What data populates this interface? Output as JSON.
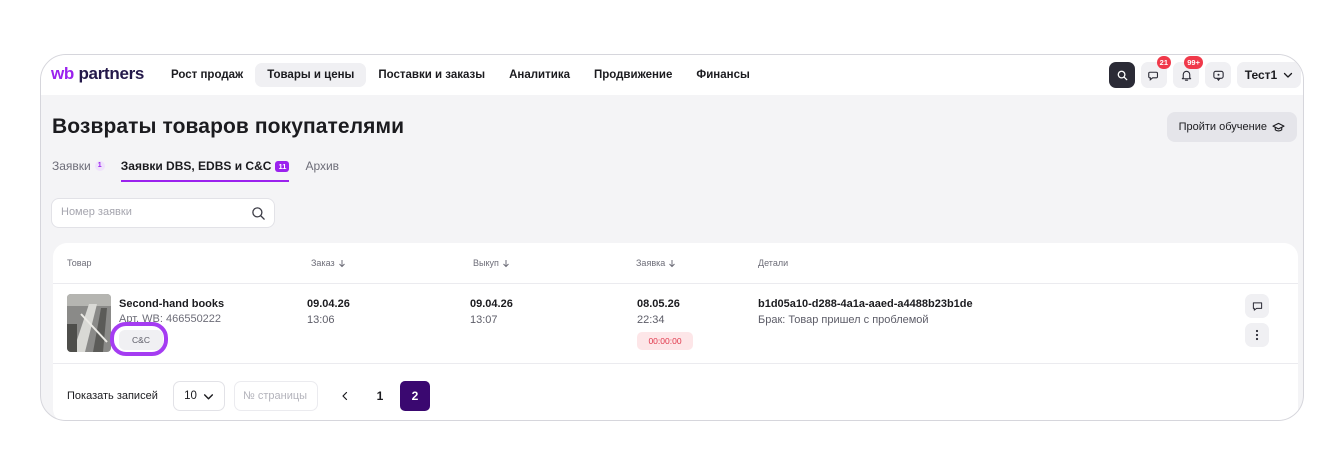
{
  "header": {
    "logo_wb": "wb",
    "logo_partners": "partners",
    "nav": [
      {
        "label": "Рост продаж",
        "active": false
      },
      {
        "label": "Товары и цены",
        "active": true
      },
      {
        "label": "Поставки и заказы",
        "active": false
      },
      {
        "label": "Аналитика",
        "active": false
      },
      {
        "label": "Продвижение",
        "active": false
      },
      {
        "label": "Финансы",
        "active": false
      }
    ],
    "chat_badge": "21",
    "notification_badge": "99+",
    "user_name": "Тест1",
    "icons": [
      "search-icon",
      "chat-icon",
      "bell-icon",
      "support-icon",
      "chevron-down-icon"
    ]
  },
  "page": {
    "title": "Возвраты товаров покупателями",
    "course_button": "Пройти обучение",
    "tabs": [
      {
        "label": "Заявки",
        "count": "1",
        "active": false
      },
      {
        "label": "Заявки DBS, EDBS и С&C",
        "count": "11",
        "active": true
      },
      {
        "label": "Архив",
        "count": "",
        "active": false
      }
    ],
    "search_placeholder": "Номер заявки"
  },
  "table": {
    "columns": {
      "product": "Товар",
      "order": "Заказ",
      "buyout": "Выкуп",
      "request": "Заявка",
      "details": "Детали"
    },
    "rows": [
      {
        "product_name": "Second-hand books",
        "article": "Арт. WB: 466550222",
        "delivery_badge": "C&C",
        "order_date": "09.04.26",
        "order_time": "13:06",
        "buyout_date": "09.04.26",
        "buyout_time": "13:07",
        "request_date": "08.05.26",
        "request_time": "22:34",
        "timer": "00:00:00",
        "request_id": "b1d05a10-d288-4a1a-aaed-a4488b23b1de",
        "reason": "Брак: Товар пришел с проблемой"
      }
    ]
  },
  "pagination": {
    "label": "Показать записей",
    "page_size": "10",
    "page_input_placeholder": "№ страницы",
    "pages": [
      "1",
      "2"
    ],
    "current_page": "2"
  },
  "colors": {
    "brand_purple": "#9b22ee",
    "highlight_ring": "#a53cf2",
    "active_page": "#3a0870",
    "notification_red": "#f0394a"
  }
}
